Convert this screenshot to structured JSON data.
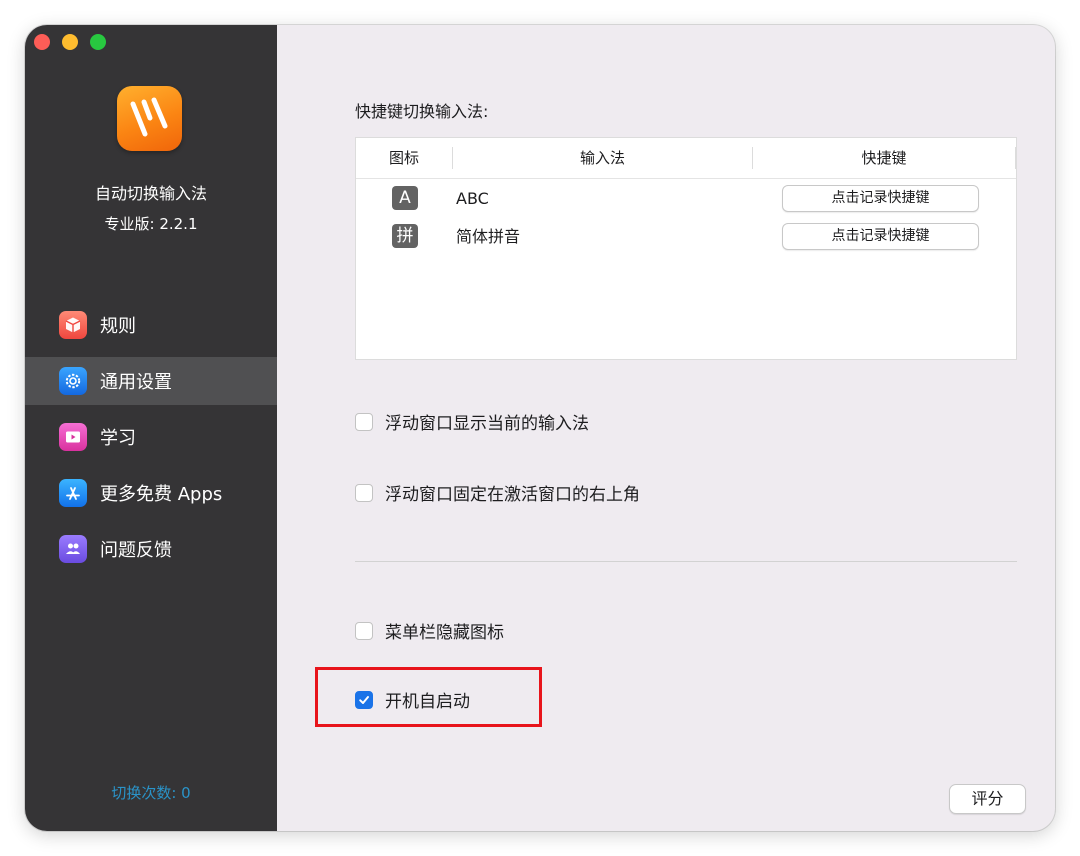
{
  "window": {
    "traffic_lights": [
      "close",
      "minimize",
      "zoom"
    ]
  },
  "sidebar": {
    "app_name": "自动切换输入法",
    "version": "专业版: 2.2.1",
    "items": [
      {
        "label": "规则",
        "icon": "cube-icon",
        "active": false
      },
      {
        "label": "通用设置",
        "icon": "gear-icon",
        "active": true
      },
      {
        "label": "学习",
        "icon": "video-icon",
        "active": false
      },
      {
        "label": "更多免费 Apps",
        "icon": "app-store-icon",
        "active": false
      },
      {
        "label": "问题反馈",
        "icon": "people-icon",
        "active": false
      }
    ],
    "switch_count": "切换次数: 0"
  },
  "main": {
    "shortcut_title": "快捷键切换输入法:",
    "table": {
      "headers": [
        "图标",
        "输入法",
        "快捷键"
      ],
      "rows": [
        {
          "icon_glyph": "A",
          "name": "ABC",
          "button": "点击记录快捷键"
        },
        {
          "icon_glyph": "拼",
          "name": "简体拼音",
          "button": "点击记录快捷键"
        }
      ]
    },
    "options": [
      {
        "label": "浮动窗口显示当前的输入法",
        "checked": false
      },
      {
        "label": "浮动窗口固定在激活窗口的右上角",
        "checked": false
      },
      {
        "label": "菜单栏隐藏图标",
        "checked": false
      },
      {
        "label": "开机自启动",
        "checked": true
      }
    ],
    "rate_button": "评分"
  },
  "colors": {
    "sidebar_bg": "#353436",
    "content_bg": "#efebf0",
    "accent": "#1a73e8",
    "highlight_border": "#e8141b",
    "switch_count_text": "#2a93c8"
  }
}
